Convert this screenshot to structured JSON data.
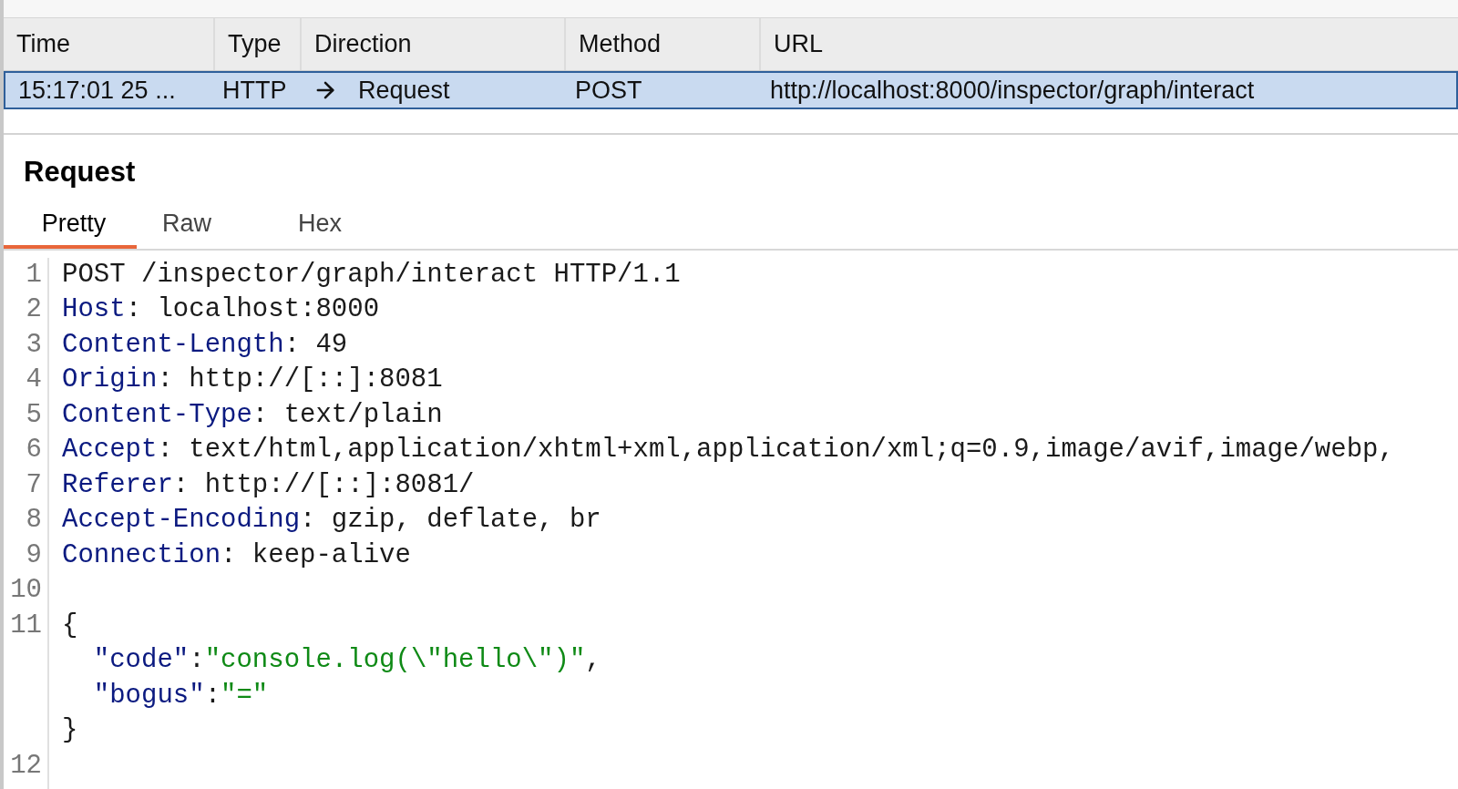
{
  "table": {
    "columns": [
      {
        "label": "Time"
      },
      {
        "label": "Type"
      },
      {
        "label": "Direction"
      },
      {
        "label": "Method"
      },
      {
        "label": "URL"
      }
    ],
    "rows": [
      {
        "selected": true,
        "time": "15:17:01 25 ...",
        "type": "HTTP",
        "direction": "Request",
        "method": "POST",
        "url": "http://localhost:8000/inspector/graph/interact"
      }
    ]
  },
  "panel": {
    "title": "Request",
    "tabs": [
      {
        "label": "Pretty",
        "selected": true
      },
      {
        "label": "Raw",
        "selected": false
      },
      {
        "label": "Hex",
        "selected": false
      }
    ],
    "lines": [
      {
        "number": "1",
        "tokens": [
          {
            "kind": "plain",
            "text": "POST /inspector/graph/interact HTTP/1.1"
          }
        ]
      },
      {
        "number": "2",
        "tokens": [
          {
            "kind": "key",
            "text": "Host"
          },
          {
            "kind": "plain",
            "text": ": localhost:8000"
          }
        ]
      },
      {
        "number": "3",
        "tokens": [
          {
            "kind": "key",
            "text": "Content-Length"
          },
          {
            "kind": "plain",
            "text": ": 49"
          }
        ]
      },
      {
        "number": "4",
        "tokens": [
          {
            "kind": "key",
            "text": "Origin"
          },
          {
            "kind": "plain",
            "text": ": http://[::]:8081"
          }
        ]
      },
      {
        "number": "5",
        "tokens": [
          {
            "kind": "key",
            "text": "Content-Type"
          },
          {
            "kind": "plain",
            "text": ": text/plain"
          }
        ]
      },
      {
        "number": "6",
        "tokens": [
          {
            "kind": "key",
            "text": "Accept"
          },
          {
            "kind": "plain",
            "text": ": text/html,application/xhtml+xml,application/xml;q=0.9,image/avif,image/webp,"
          }
        ]
      },
      {
        "number": "7",
        "tokens": [
          {
            "kind": "key",
            "text": "Referer"
          },
          {
            "kind": "plain",
            "text": ": http://[::]:8081/"
          }
        ]
      },
      {
        "number": "8",
        "tokens": [
          {
            "kind": "key",
            "text": "Accept-Encoding"
          },
          {
            "kind": "plain",
            "text": ": gzip, deflate, br"
          }
        ]
      },
      {
        "number": "9",
        "tokens": [
          {
            "kind": "key",
            "text": "Connection"
          },
          {
            "kind": "plain",
            "text": ": keep-alive"
          }
        ]
      },
      {
        "number": "10"
      },
      {
        "number": "11",
        "tokens": [
          {
            "kind": "plain",
            "text": "{"
          }
        ]
      },
      {
        "tokens": [
          {
            "kind": "key",
            "text": "  \"code\""
          },
          {
            "kind": "plain",
            "text": ":"
          },
          {
            "kind": "string",
            "text": "\"console.log(\\\"hello\\\")\""
          },
          {
            "kind": "plain",
            "text": ","
          }
        ]
      },
      {
        "tokens": [
          {
            "kind": "key",
            "text": "  \"bogus\""
          },
          {
            "kind": "plain",
            "text": ":"
          },
          {
            "kind": "string",
            "text": "\"=\""
          }
        ]
      },
      {
        "tokens": [
          {
            "kind": "plain",
            "text": "}"
          }
        ]
      },
      {
        "number": "12"
      }
    ]
  }
}
